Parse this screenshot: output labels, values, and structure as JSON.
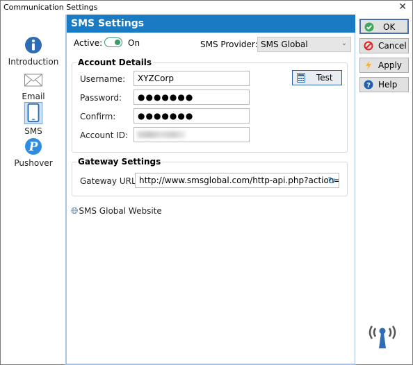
{
  "window": {
    "title": "Communication Settings",
    "close_glyph": "✕"
  },
  "sidebar": {
    "items": [
      {
        "label": "Introduction",
        "icon": "info-icon"
      },
      {
        "label": "Email",
        "icon": "envelope-icon"
      },
      {
        "label": "SMS",
        "icon": "phone-icon",
        "selected": true
      },
      {
        "label": "Pushover",
        "icon": "pushover-icon"
      }
    ]
  },
  "panel": {
    "title": "SMS Settings",
    "active": {
      "label": "Active:",
      "state": "On",
      "value": true
    },
    "provider": {
      "label": "SMS Provider:",
      "value": "SMS Global",
      "chevron": "⌄"
    },
    "account": {
      "title": "Account Details",
      "username_label": "Username:",
      "username_value": "XYZCorp",
      "password_label": "Password:",
      "password_value": "●●●●●●●",
      "confirm_label": "Confirm:",
      "confirm_value": "●●●●●●●",
      "account_id_label": "Account ID:",
      "test_label": "Test"
    },
    "gateway": {
      "title": "Gateway Settings",
      "url_label": "Gateway URL:",
      "url_value": "http://www.smsglobal.com/http-api.php?action=se"
    },
    "website_link": "SMS Global Website"
  },
  "buttons": {
    "ok": "OK",
    "cancel": "Cancel",
    "apply": "Apply",
    "help": "Help"
  },
  "colors": {
    "accent": "#1a7ac4",
    "toggle": "#3a9b6a"
  }
}
